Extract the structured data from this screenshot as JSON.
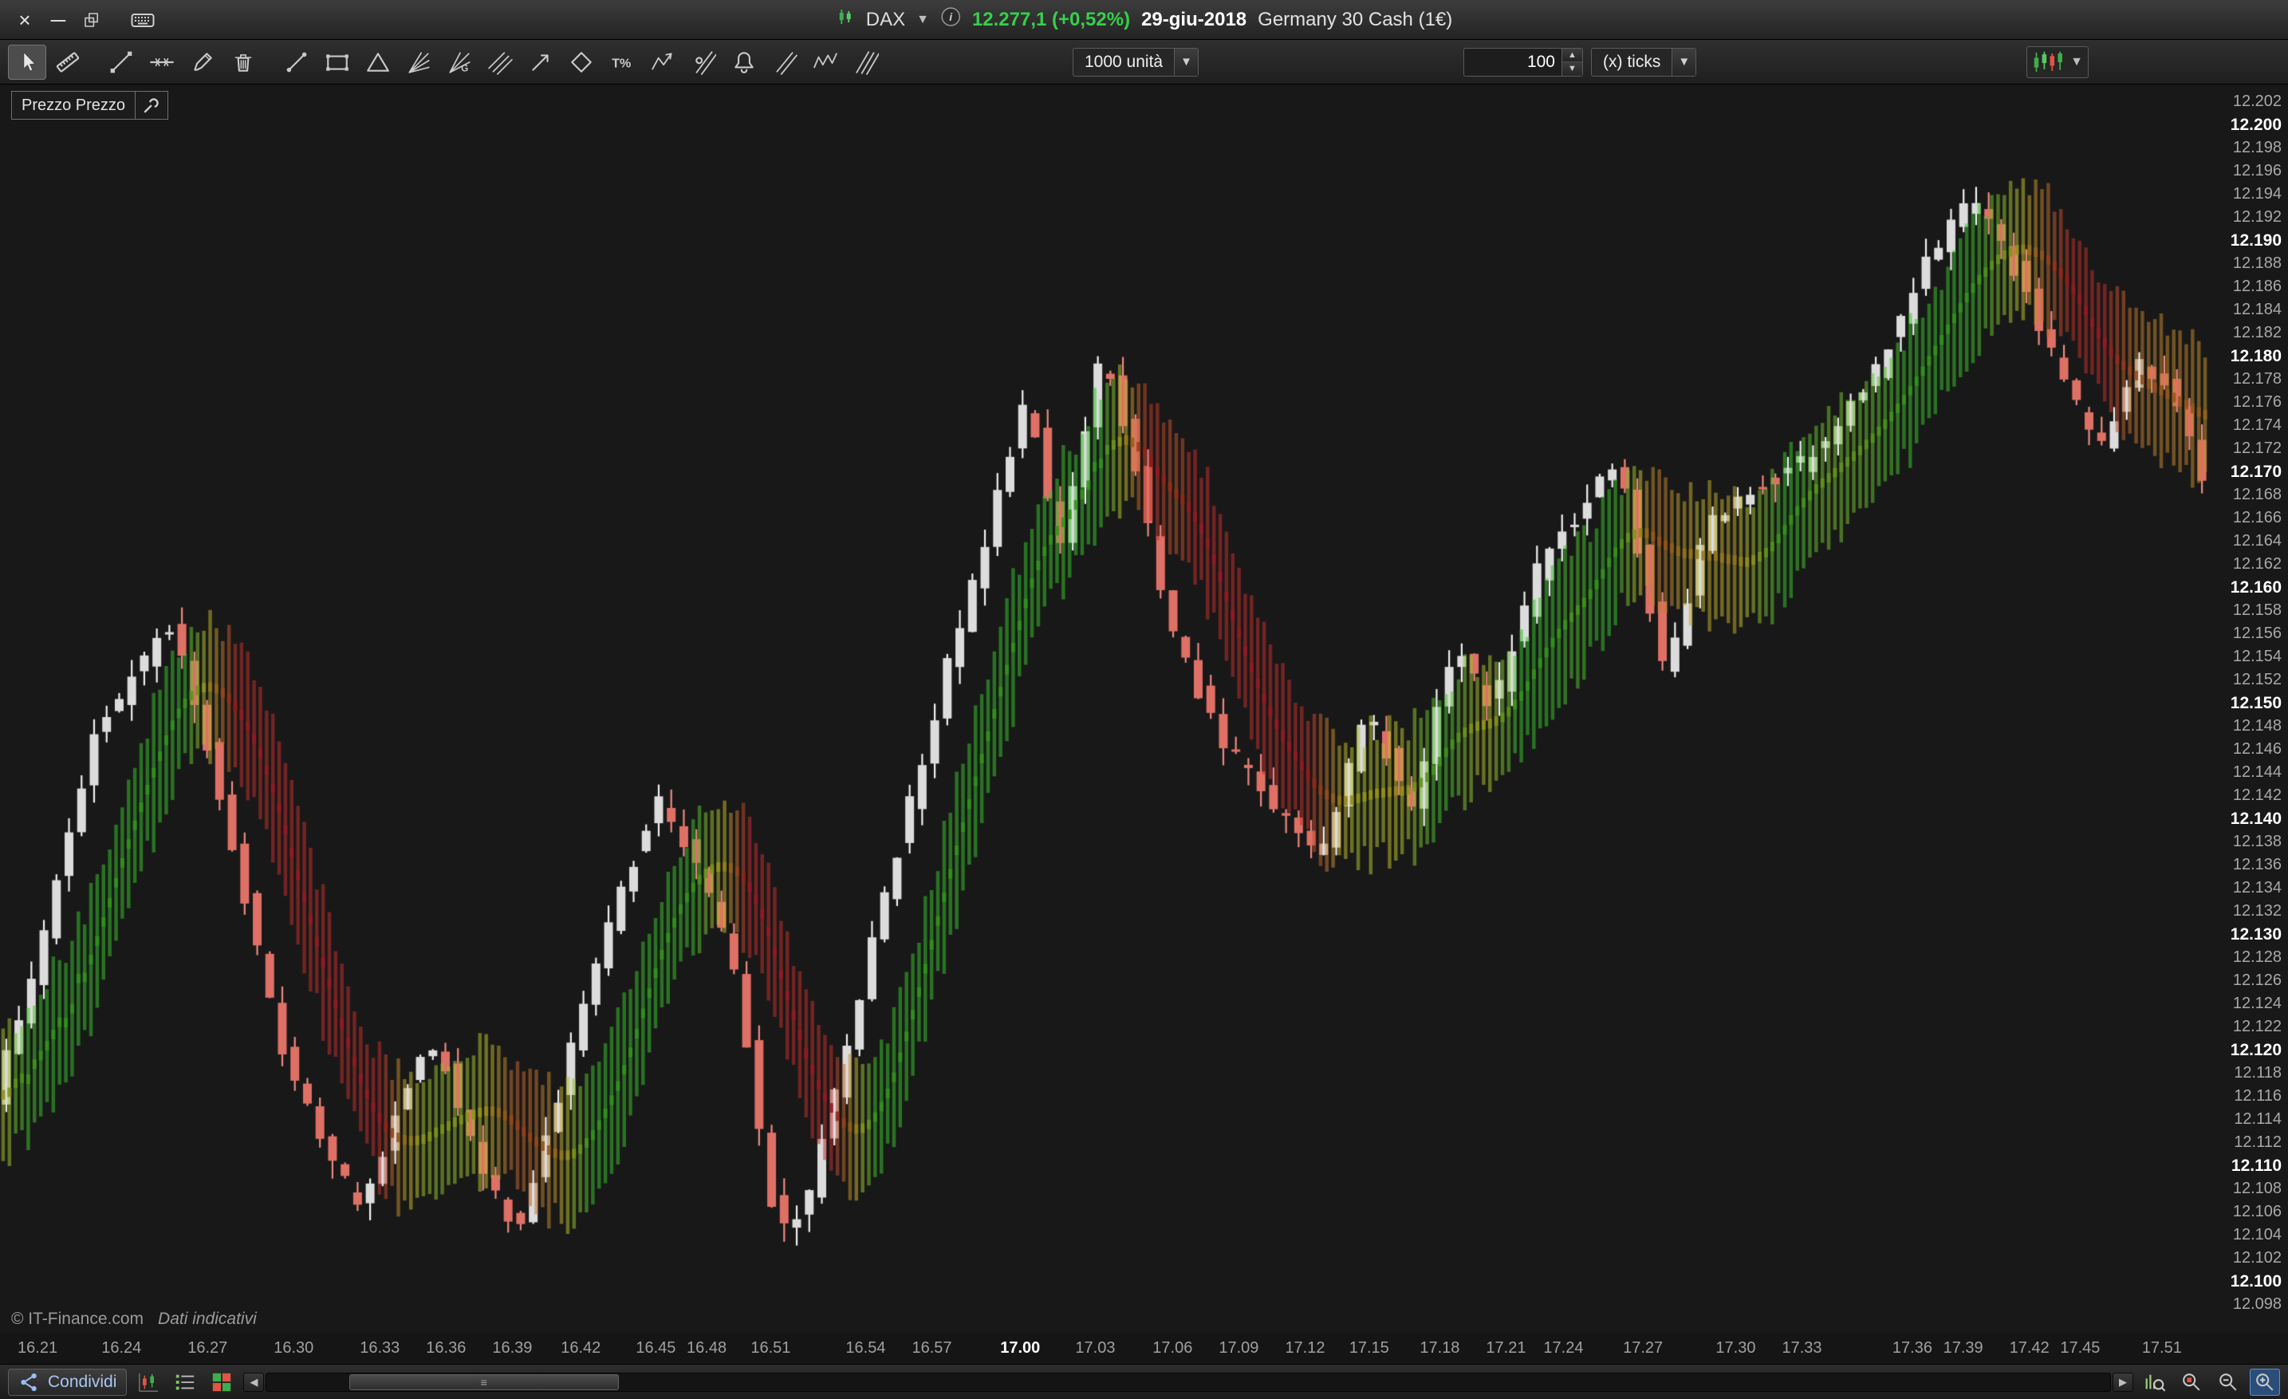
{
  "title_bar": {
    "instrument": "DAX",
    "price": "12.277,1 (+0,52%)",
    "price_color": "#35d04a",
    "date": "29-giu-2018",
    "description": "Germany 30 Cash (1€)"
  },
  "toolbar": {
    "units_dropdown": "1000 unità",
    "ticks_value": "100",
    "ticks_type": "(x) ticks",
    "gann_letter": "G",
    "percent_label": "T%"
  },
  "chart": {
    "indicator_label": "Prezzo Prezzo",
    "copyright": "© IT-Finance.com",
    "disclaimer": "Dati indicativi"
  },
  "status_bar": {
    "share_label": "Condividi"
  },
  "y_axis": {
    "labels": [
      {
        "t": "12.202",
        "v": 12.202,
        "b": false
      },
      {
        "t": "12.200",
        "v": 12.2,
        "b": true
      },
      {
        "t": "12.198",
        "v": 12.198,
        "b": false
      },
      {
        "t": "12.196",
        "v": 12.196,
        "b": false
      },
      {
        "t": "12.194",
        "v": 12.194,
        "b": false
      },
      {
        "t": "12.192",
        "v": 12.192,
        "b": false
      },
      {
        "t": "12.190",
        "v": 12.19,
        "b": true
      },
      {
        "t": "12.188",
        "v": 12.188,
        "b": false
      },
      {
        "t": "12.186",
        "v": 12.186,
        "b": false
      },
      {
        "t": "12.184",
        "v": 12.184,
        "b": false
      },
      {
        "t": "12.182",
        "v": 12.182,
        "b": false
      },
      {
        "t": "12.180",
        "v": 12.18,
        "b": true
      },
      {
        "t": "12.178",
        "v": 12.178,
        "b": false
      },
      {
        "t": "12.176",
        "v": 12.176,
        "b": false
      },
      {
        "t": "12.174",
        "v": 12.174,
        "b": false
      },
      {
        "t": "12.172",
        "v": 12.172,
        "b": false
      },
      {
        "t": "12.170",
        "v": 12.17,
        "b": true
      },
      {
        "t": "12.168",
        "v": 12.168,
        "b": false
      },
      {
        "t": "12.166",
        "v": 12.166,
        "b": false
      },
      {
        "t": "12.164",
        "v": 12.164,
        "b": false
      },
      {
        "t": "12.162",
        "v": 12.162,
        "b": false
      },
      {
        "t": "12.160",
        "v": 12.16,
        "b": true
      },
      {
        "t": "12.158",
        "v": 12.158,
        "b": false
      },
      {
        "t": "12.156",
        "v": 12.156,
        "b": false
      },
      {
        "t": "12.154",
        "v": 12.154,
        "b": false
      },
      {
        "t": "12.152",
        "v": 12.152,
        "b": false
      },
      {
        "t": "12.150",
        "v": 12.15,
        "b": true
      },
      {
        "t": "12.148",
        "v": 12.148,
        "b": false
      },
      {
        "t": "12.146",
        "v": 12.146,
        "b": false
      },
      {
        "t": "12.144",
        "v": 12.144,
        "b": false
      },
      {
        "t": "12.142",
        "v": 12.142,
        "b": false
      },
      {
        "t": "12.140",
        "v": 12.14,
        "b": true
      },
      {
        "t": "12.138",
        "v": 12.138,
        "b": false
      },
      {
        "t": "12.136",
        "v": 12.136,
        "b": false
      },
      {
        "t": "12.134",
        "v": 12.134,
        "b": false
      },
      {
        "t": "12.132",
        "v": 12.132,
        "b": false
      },
      {
        "t": "12.130",
        "v": 12.13,
        "b": true
      },
      {
        "t": "12.128",
        "v": 12.128,
        "b": false
      },
      {
        "t": "12.126",
        "v": 12.126,
        "b": false
      },
      {
        "t": "12.124",
        "v": 12.124,
        "b": false
      },
      {
        "t": "12.122",
        "v": 12.122,
        "b": false
      },
      {
        "t": "12.120",
        "v": 12.12,
        "b": true
      },
      {
        "t": "12.118",
        "v": 12.118,
        "b": false
      },
      {
        "t": "12.116",
        "v": 12.116,
        "b": false
      },
      {
        "t": "12.114",
        "v": 12.114,
        "b": false
      },
      {
        "t": "12.112",
        "v": 12.112,
        "b": false
      },
      {
        "t": "12.110",
        "v": 12.11,
        "b": true
      },
      {
        "t": "12.108",
        "v": 12.108,
        "b": false
      },
      {
        "t": "12.106",
        "v": 12.106,
        "b": false
      },
      {
        "t": "12.104",
        "v": 12.104,
        "b": false
      },
      {
        "t": "12.102",
        "v": 12.102,
        "b": false
      },
      {
        "t": "12.100",
        "v": 12.1,
        "b": true
      },
      {
        "t": "12.098",
        "v": 12.098,
        "b": false
      }
    ]
  },
  "x_axis": {
    "labels": [
      {
        "t": "16.21",
        "p": 0.017,
        "b": false
      },
      {
        "t": "16.24",
        "p": 0.055,
        "b": false
      },
      {
        "t": "16.27",
        "p": 0.094,
        "b": false
      },
      {
        "t": "16.30",
        "p": 0.133,
        "b": false
      },
      {
        "t": "16.33",
        "p": 0.172,
        "b": false
      },
      {
        "t": "16.36",
        "p": 0.202,
        "b": false
      },
      {
        "t": "16.39",
        "p": 0.232,
        "b": false
      },
      {
        "t": "16.42",
        "p": 0.263,
        "b": false
      },
      {
        "t": "16.45",
        "p": 0.297,
        "b": false
      },
      {
        "t": "16.48",
        "p": 0.32,
        "b": false
      },
      {
        "t": "16.51",
        "p": 0.349,
        "b": false
      },
      {
        "t": "16.54",
        "p": 0.392,
        "b": false
      },
      {
        "t": "16.57",
        "p": 0.422,
        "b": false
      },
      {
        "t": "17.00",
        "p": 0.462,
        "b": true
      },
      {
        "t": "17.03",
        "p": 0.496,
        "b": false
      },
      {
        "t": "17.06",
        "p": 0.531,
        "b": false
      },
      {
        "t": "17.09",
        "p": 0.561,
        "b": false
      },
      {
        "t": "17.12",
        "p": 0.591,
        "b": false
      },
      {
        "t": "17.15",
        "p": 0.62,
        "b": false
      },
      {
        "t": "17.18",
        "p": 0.652,
        "b": false
      },
      {
        "t": "17.21",
        "p": 0.682,
        "b": false
      },
      {
        "t": "17.24",
        "p": 0.708,
        "b": false
      },
      {
        "t": "17.27",
        "p": 0.744,
        "b": false
      },
      {
        "t": "17.30",
        "p": 0.786,
        "b": false
      },
      {
        "t": "17.33",
        "p": 0.816,
        "b": false
      },
      {
        "t": "17.36",
        "p": 0.866,
        "b": false
      },
      {
        "t": "17.39",
        "p": 0.889,
        "b": false
      },
      {
        "t": "17.42",
        "p": 0.919,
        "b": false
      },
      {
        "t": "17.45",
        "p": 0.942,
        "b": false
      },
      {
        "t": "17.51",
        "p": 0.979,
        "b": false
      }
    ]
  },
  "chart_data": {
    "type": "candlestick",
    "title": "DAX Germany 30 Cash — tick chart (1000 unità, 100 (x) ticks)",
    "visible_price_range": [
      12.0955,
      12.2035
    ],
    "candles": 176,
    "up_color": "#dcdcdc",
    "down_color": "#df7066",
    "up_stroke": "#f2f2f2",
    "down_stroke": "#ef8a80",
    "ribbon": {
      "half_height": 0.0054,
      "up_hue": 115,
      "down_hue": 2
    },
    "path": [
      [
        0.0,
        12.116
      ],
      [
        0.02,
        12.128
      ],
      [
        0.045,
        12.147
      ],
      [
        0.08,
        12.157
      ],
      [
        0.1,
        12.144
      ],
      [
        0.13,
        12.12
      ],
      [
        0.165,
        12.106
      ],
      [
        0.185,
        12.116
      ],
      [
        0.2,
        12.121
      ],
      [
        0.22,
        12.11
      ],
      [
        0.238,
        12.104
      ],
      [
        0.27,
        12.126
      ],
      [
        0.3,
        12.142
      ],
      [
        0.318,
        12.136
      ],
      [
        0.335,
        12.127
      ],
      [
        0.355,
        12.104
      ],
      [
        0.368,
        12.107
      ],
      [
        0.4,
        12.131
      ],
      [
        0.43,
        12.152
      ],
      [
        0.455,
        12.168
      ],
      [
        0.468,
        12.177
      ],
      [
        0.482,
        12.163
      ],
      [
        0.502,
        12.181
      ],
      [
        0.515,
        12.172
      ],
      [
        0.53,
        12.158
      ],
      [
        0.555,
        12.147
      ],
      [
        0.58,
        12.141
      ],
      [
        0.6,
        12.137
      ],
      [
        0.622,
        12.149
      ],
      [
        0.642,
        12.141
      ],
      [
        0.662,
        12.155
      ],
      [
        0.678,
        12.149
      ],
      [
        0.7,
        12.162
      ],
      [
        0.72,
        12.167
      ],
      [
        0.735,
        12.171
      ],
      [
        0.757,
        12.152
      ],
      [
        0.775,
        12.165
      ],
      [
        0.8,
        12.169
      ],
      [
        0.822,
        12.171
      ],
      [
        0.85,
        12.178
      ],
      [
        0.875,
        12.188
      ],
      [
        0.895,
        12.194
      ],
      [
        0.912,
        12.189
      ],
      [
        0.932,
        12.18
      ],
      [
        0.953,
        12.172
      ],
      [
        0.972,
        12.18
      ],
      [
        0.985,
        12.177
      ],
      [
        1.0,
        12.17
      ]
    ]
  }
}
